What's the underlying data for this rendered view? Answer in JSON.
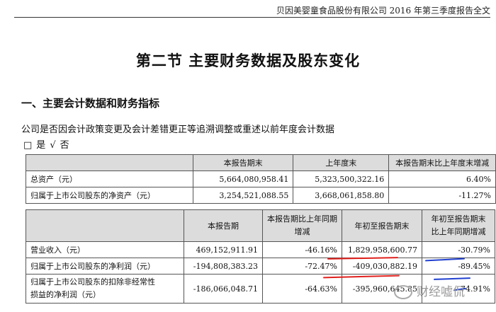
{
  "header": {
    "title": "贝因美婴童食品股份有限公司 2016 年第三季度报告全文"
  },
  "section_title": "第二节  主要财务数据及股东变化",
  "subsection_title": "一、主要会计数据和财务指标",
  "question": "公司是否因会计政策变更及会计差错更正等追溯调整或重述以前年度会计数据",
  "answer": {
    "box": "□",
    "yes": "是",
    "check": "√",
    "no": "否"
  },
  "table1": {
    "headers": [
      "",
      "本报告期末",
      "上年度末",
      "本报告期末比上年度末增减"
    ],
    "rows": [
      {
        "label": "总资产（元）",
        "c1": "5,664,080,958.41",
        "c2": "5,323,500,322.16",
        "c3": "6.40%"
      },
      {
        "label": "归属于上市公司股东的净资产（元）",
        "c1": "3,254,521,088.55",
        "c2": "3,668,061,858.80",
        "c3": "-11.27%"
      }
    ]
  },
  "table2": {
    "headers": [
      "",
      "本报告期",
      "本报告期比上年同期增减",
      "年初至报告期末",
      "年初至报告期末比上年同期增减"
    ],
    "header_lines": {
      "h2a": "本报告期比上年同期",
      "h2b": "增减",
      "h4a": "年初至报告期末",
      "h4b": "比上年同期增减"
    },
    "rows": [
      {
        "label": "营业收入（元）",
        "c1": "469,152,911.91",
        "c2": "-46.16%",
        "c3": "1,829,958,600.77",
        "c4": "-30.79%"
      },
      {
        "label": "归属于上市公司股东的净利润（元）",
        "c1": "-194,808,383.23",
        "c2": "-72.47%",
        "c3": "-409,030,882.19",
        "c4": "-89.45%"
      },
      {
        "label_a": "归属于上市公司股东的扣除非经常性",
        "label_b": "损益的净利润（元）",
        "c1": "-186,066,048.71",
        "c2": "-64.63%",
        "c3": "-395,960,645.85",
        "c4": "-74.91%"
      }
    ]
  },
  "annotation_colors": {
    "red": "#e0201c",
    "blue": "#1f3fd0"
  },
  "watermark": "财经嘘侃"
}
